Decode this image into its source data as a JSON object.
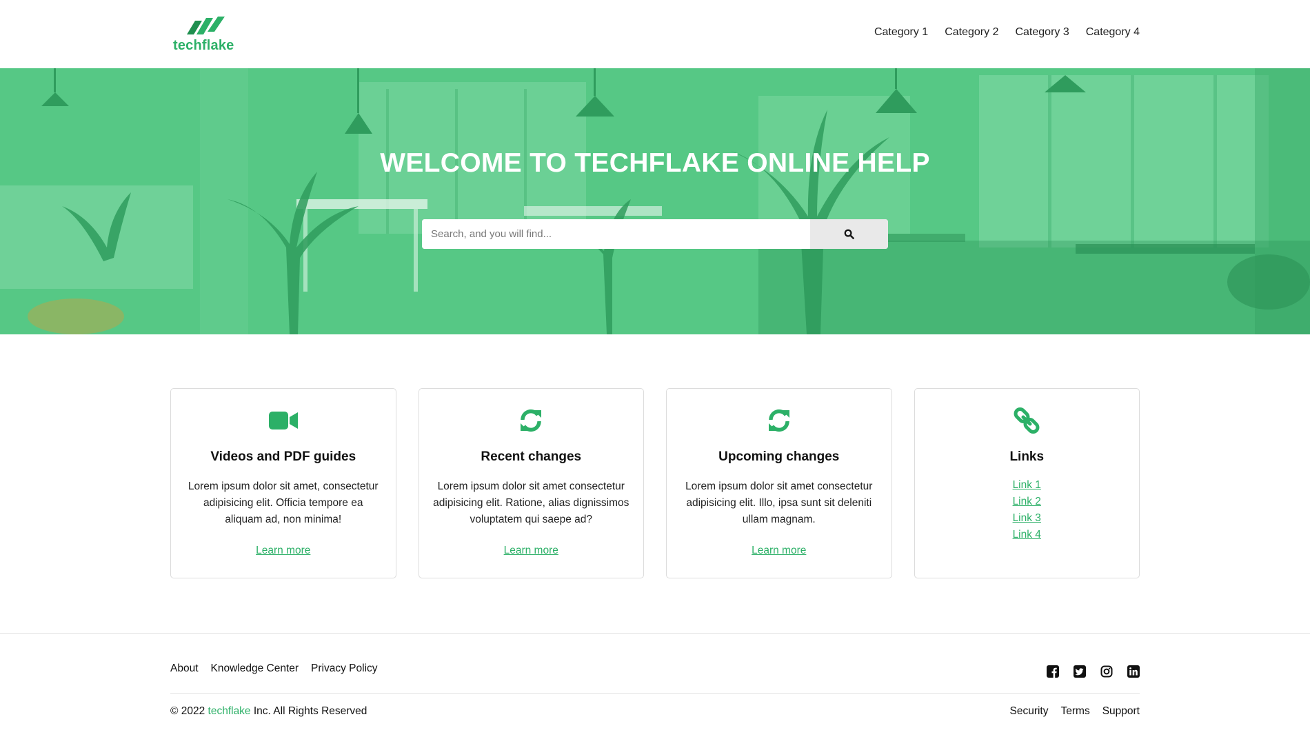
{
  "brand": {
    "name": "techflake",
    "accent_color": "#2cb067",
    "hero_overlay_color": "#4fc47f"
  },
  "nav": {
    "items": [
      {
        "label": "Category 1"
      },
      {
        "label": "Category 2"
      },
      {
        "label": "Category 3"
      },
      {
        "label": "Category 4"
      }
    ]
  },
  "hero": {
    "title": "WELCOME TO TECHFLAKE ONLINE HELP",
    "search_placeholder": "Search, and you will find...",
    "search_icon": "search-icon"
  },
  "cards": [
    {
      "icon": "video-camera-icon",
      "title": "Videos and PDF guides",
      "text": "Lorem ipsum dolor sit amet, consectetur adipisicing elit. Officia tempore ea aliquam ad, non minima!",
      "link": "Learn more"
    },
    {
      "icon": "refresh-icon",
      "title": "Recent changes",
      "text": "Lorem ipsum dolor sit amet consectetur adipisicing elit. Ratione, alias dignissimos voluptatem qui saepe ad?",
      "link": "Learn more"
    },
    {
      "icon": "refresh-icon",
      "title": "Upcoming changes",
      "text": "Lorem ipsum dolor sit amet consectetur adipisicing elit. Illo, ipsa sunt sit deleniti ullam magnam.",
      "link": "Learn more"
    },
    {
      "icon": "chain-link-icon",
      "title": "Links",
      "links": [
        "Link 1",
        "Link 2",
        "Link 3",
        "Link 4"
      ]
    }
  ],
  "footer": {
    "links": [
      "About",
      "Knowledge Center",
      "Privacy Policy"
    ],
    "social": [
      "facebook-icon",
      "twitter-icon",
      "instagram-icon",
      "linkedin-icon"
    ],
    "copyright_prefix": "© 2022 ",
    "copyright_brand": "techflake",
    "copyright_suffix": " Inc. All Rights Reserved",
    "bottom_links": [
      "Security",
      "Terms",
      "Support"
    ]
  }
}
